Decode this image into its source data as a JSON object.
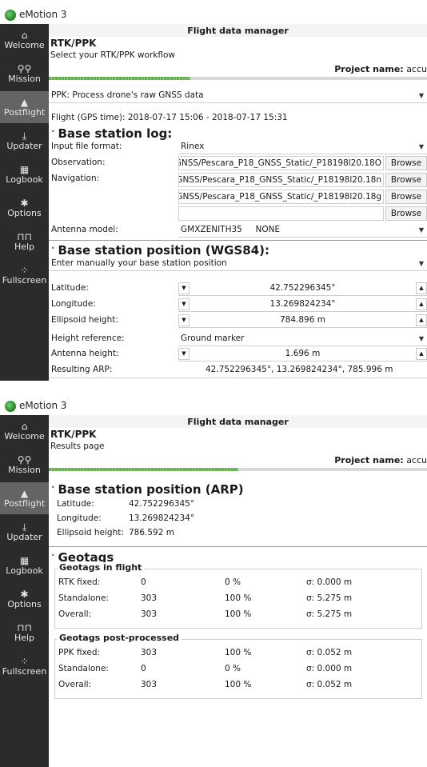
{
  "app": {
    "title": "eMotion 3",
    "nav": [
      {
        "icon": "⌂",
        "label": "Welcome"
      },
      {
        "icon": "⚲⚲",
        "label": "Mission"
      },
      {
        "icon": "▲",
        "label": "Postflight"
      },
      {
        "icon": "⤓",
        "label": "Updater"
      },
      {
        "icon": "▦",
        "label": "Logbook"
      },
      {
        "icon": "✱",
        "label": "Options"
      },
      {
        "icon": "⊓⊓",
        "label": "Help"
      },
      {
        "icon": "⁘",
        "label": "Fullscreen"
      }
    ]
  },
  "screen1": {
    "header": "Flight data manager",
    "title": "RTK/PPK",
    "subtitle": "Select your RTK/PPK workflow",
    "project_label": "Project name:",
    "project_value": "accu",
    "workflow": "PPK: Process drone's raw GNSS data",
    "flight_time": "Flight (GPS time):  2018-07-17 15:06 - 2018-07-17 15:31",
    "base_log": {
      "title": "Base station log:",
      "input_format_label": "Input file format:",
      "input_format_value": "Rinex",
      "observation_label": "Observation:",
      "observation_value": "GNSS/Pescara_P18_GNSS_Static/_P18198l20.18O",
      "navigation_label": "Navigation:",
      "navigation_value": "GNSS/Pescara_P18_GNSS_Static/_P18198l20.18n",
      "navigation2_value": "GNSS/Pescara_P18_GNSS_Static/_P18198l20.18g",
      "empty_value": "",
      "browse": "Browse",
      "antenna_label": "Antenna model:",
      "antenna_value": "GMXZENITH35     NONE"
    },
    "base_pos": {
      "title": "Base station position (WGS84):",
      "mode": "Enter manually your base station position",
      "latitude_label": "Latitude:",
      "latitude_value": "42.752296345°",
      "longitude_label": "Longitude:",
      "longitude_value": "13.269824234°",
      "ellipsoid_label": "Ellipsoid height:",
      "ellipsoid_value": "784.896 m",
      "height_ref_label": "Height reference:",
      "height_ref_value": "Ground marker",
      "antenna_height_label": "Antenna height:",
      "antenna_height_value": "1.696 m",
      "arp_label": "Resulting ARP:",
      "arp_value": "42.752296345°, 13.269824234°, 785.996 m"
    },
    "progress": 0.375
  },
  "screen2": {
    "header": "Flight data manager",
    "title": "RTK/PPK",
    "subtitle": "Results page",
    "project_label": "Project name:",
    "project_value": "accu",
    "base_arp": {
      "title": "Base station position (ARP)",
      "latitude_label": "Latitude:",
      "latitude_value": "42.752296345°",
      "longitude_label": "Longitude:",
      "longitude_value": "13.269824234°",
      "ellipsoid_label": "Ellipsoid height:",
      "ellipsoid_value": "786.592 m"
    },
    "geotags": {
      "title": "Geotags",
      "in_flight_title": "Geotags in flight",
      "in_flight": [
        {
          "label": "RTK fixed:",
          "count": "0",
          "pct": "0 %",
          "sigma": "σ: 0.000 m"
        },
        {
          "label": "Standalone:",
          "count": "303",
          "pct": "100 %",
          "sigma": "σ: 5.275 m"
        },
        {
          "label": "Overall:",
          "count": "303",
          "pct": "100 %",
          "sigma": "σ: 5.275 m"
        }
      ],
      "post_title": "Geotags post-processed",
      "post": [
        {
          "label": "PPK fixed:",
          "count": "303",
          "pct": "100 %",
          "sigma": "σ: 0.052 m"
        },
        {
          "label": "Standalone:",
          "count": "0",
          "pct": "0 %",
          "sigma": "σ: 0.000 m"
        },
        {
          "label": "Overall:",
          "count": "303",
          "pct": "100 %",
          "sigma": "σ: 0.052 m"
        }
      ]
    },
    "progress": 0.5
  }
}
